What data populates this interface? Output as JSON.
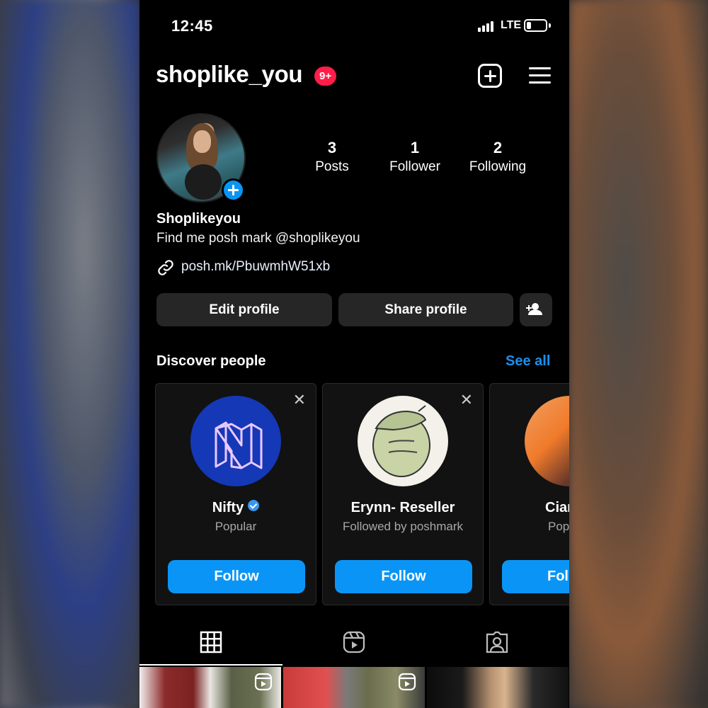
{
  "status_bar": {
    "time": "12:45",
    "network": "LTE"
  },
  "header": {
    "username": "shoplike_you",
    "notification_badge": "9+"
  },
  "stats": [
    {
      "value": "3",
      "label": "Posts"
    },
    {
      "value": "1",
      "label": "Follower"
    },
    {
      "value": "2",
      "label": "Following"
    }
  ],
  "profile": {
    "display_name": "Shoplikeyou",
    "bio": "Find me posh mark @shoplikeyou",
    "link": "posh.mk/PbuwmhW51xb"
  },
  "actions": {
    "edit_profile": "Edit profile",
    "share_profile": "Share profile"
  },
  "discover": {
    "title": "Discover people",
    "see_all": "See all",
    "cards": [
      {
        "name": "Nifty",
        "subtitle": "Popular",
        "follow": "Follow",
        "verified": true
      },
      {
        "name": "Erynn- Reseller",
        "subtitle": "Followed by poshmark",
        "follow": "Follow",
        "verified": false
      },
      {
        "name": "Ciar",
        "subtitle": "Pop",
        "follow": "Fol",
        "verified": false
      }
    ]
  },
  "tabs": [
    "grid-icon",
    "reels-icon",
    "tagged-icon"
  ],
  "colors": {
    "accent": "#0a95f6",
    "badge": "#ff1e48",
    "link": "#1a8ff0",
    "background": "#000000",
    "button": "#262626"
  }
}
